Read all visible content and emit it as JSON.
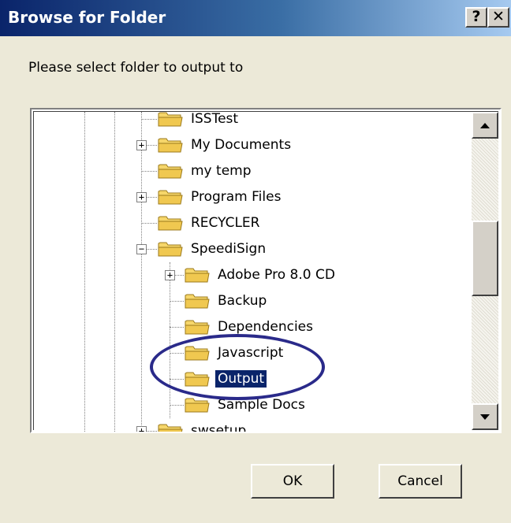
{
  "window": {
    "title": "Browse for Folder",
    "help_label": "?",
    "close_label": "✕"
  },
  "dialog": {
    "prompt": "Please select folder to output to"
  },
  "tree": {
    "items": [
      {
        "label": "ISSTest",
        "expander": "",
        "selected": false
      },
      {
        "label": "My Documents",
        "expander": "+",
        "selected": false
      },
      {
        "label": "my temp",
        "expander": "",
        "selected": false
      },
      {
        "label": "Program Files",
        "expander": "+",
        "selected": false
      },
      {
        "label": "RECYCLER",
        "expander": "",
        "selected": false
      },
      {
        "label": "SpeediSign",
        "expander": "−",
        "selected": false
      },
      {
        "label": "Adobe Pro 8.0 CD",
        "expander": "+",
        "selected": false
      },
      {
        "label": "Backup",
        "expander": "",
        "selected": false
      },
      {
        "label": "Dependencies",
        "expander": "",
        "selected": false
      },
      {
        "label": "Javascript",
        "expander": "",
        "selected": false
      },
      {
        "label": "Output",
        "expander": "",
        "selected": true
      },
      {
        "label": "Sample Docs",
        "expander": "",
        "selected": false
      },
      {
        "label": "swsetup",
        "expander": "+",
        "selected": false
      }
    ]
  },
  "buttons": {
    "ok": "OK",
    "cancel": "Cancel"
  },
  "colors": {
    "title_gradient_start": "#0a246a",
    "selection": "#0a246a",
    "annotation": "#2a2a8a",
    "folder": "#f0c850"
  }
}
